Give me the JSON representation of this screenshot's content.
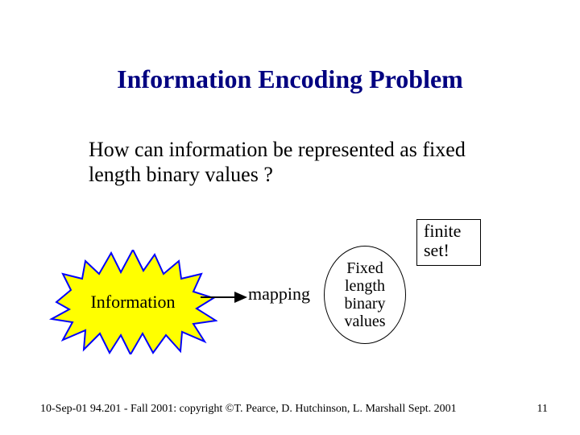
{
  "title": "Information Encoding Problem",
  "body": "How can information be represented as fixed length binary values ?",
  "starburst_label": "Information",
  "arrow_label": "mapping",
  "oval_text": "Fixed length binary values",
  "finite_box": "finite set!",
  "footer": "10-Sep-01 94.201 - Fall 2001: copyright ©T. Pearce, D. Hutchinson, L. Marshall Sept. 2001",
  "page_number": "11",
  "colors": {
    "title": "#000080",
    "starburst_fill": "#ffff00",
    "starburst_stroke": "#0000ff"
  }
}
